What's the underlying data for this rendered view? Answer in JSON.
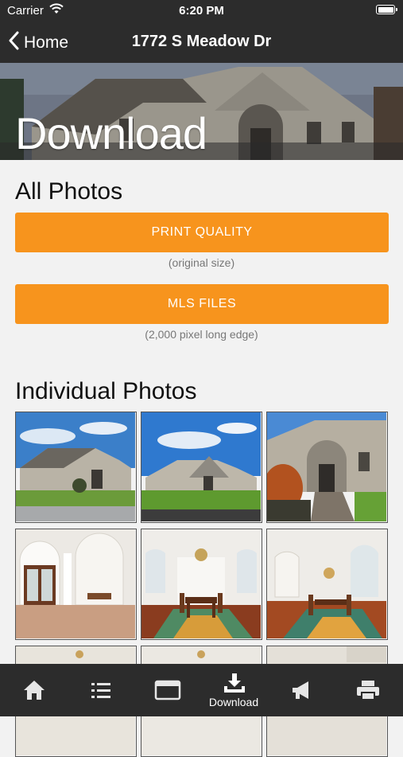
{
  "status_bar": {
    "carrier": "Carrier",
    "time": "6:20 PM"
  },
  "nav": {
    "back_label": "Home",
    "title": "1772 S Meadow Dr"
  },
  "hero": {
    "title": "Download"
  },
  "all_photos": {
    "heading": "All Photos",
    "print_button": "PRINT QUALITY",
    "print_note": "(original size)",
    "mls_button": "MLS FILES",
    "mls_note": "(2,000 pixel long edge)"
  },
  "individual": {
    "heading": "Individual Photos"
  },
  "tabs": [
    {
      "icon": "home-icon",
      "label": ""
    },
    {
      "icon": "list-icon",
      "label": ""
    },
    {
      "icon": "browser-window-icon",
      "label": ""
    },
    {
      "icon": "download-icon",
      "label": "Download"
    },
    {
      "icon": "megaphone-icon",
      "label": ""
    },
    {
      "icon": "printer-icon",
      "label": ""
    }
  ],
  "colors": {
    "accent": "#f7941d",
    "bar": "#2c2c2c",
    "background": "#f2f2f2"
  }
}
